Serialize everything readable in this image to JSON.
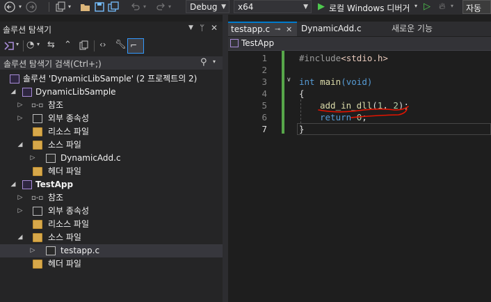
{
  "toolbar": {
    "config": "Debug",
    "platform": "x64",
    "run_label": "로컬 Windows 디버거",
    "auto_label": "자동"
  },
  "solution_explorer": {
    "title": "솔루션 탐색기",
    "search_placeholder": "솔루션 탐색기 검색(Ctrl+;)",
    "solution_label": "솔루션 'DynamicLibSample'  (2 프로젝트의 2)",
    "projects": [
      {
        "name": "DynamicLibSample",
        "items": [
          {
            "label": "참조"
          },
          {
            "label": "외부 종속성"
          },
          {
            "label": "리소스 파일"
          },
          {
            "label": "소스 파일"
          },
          {
            "label": "DynamicAdd.c"
          },
          {
            "label": "헤더 파일"
          }
        ]
      },
      {
        "name": "TestApp",
        "items": [
          {
            "label": "참조"
          },
          {
            "label": "외부 종속성"
          },
          {
            "label": "리소스 파일"
          },
          {
            "label": "소스 파일"
          },
          {
            "label": "testapp.c"
          },
          {
            "label": "헤더 파일"
          }
        ]
      }
    ]
  },
  "editor": {
    "tabs": [
      {
        "label": "testapp.c"
      },
      {
        "label": "DynamicAdd.c"
      },
      {
        "label": "새로운 기능"
      }
    ],
    "nav_project": "TestApp",
    "line_numbers": [
      "1",
      "2",
      "3",
      "4",
      "5",
      "6",
      "7"
    ],
    "code": {
      "l1_directive": "#include",
      "l1_file": "<stdio.h>",
      "l3_type": "int",
      "l3_name": "main",
      "l3_rest": "(void)",
      "l4": "{",
      "l5_fn": "add_in_dll",
      "l5_open": "(",
      "l5_a": "1",
      "l5_sep": ", ",
      "l5_b": "2",
      "l5_close": ");",
      "l6_kw": "return",
      "l6_num": "0",
      "l6_end": ";",
      "l7": "}"
    }
  },
  "colors": {
    "accent": "#007acc",
    "change_bar": "#57a64a",
    "keyword": "#569cd6",
    "error_squiggle": "#e51400"
  }
}
